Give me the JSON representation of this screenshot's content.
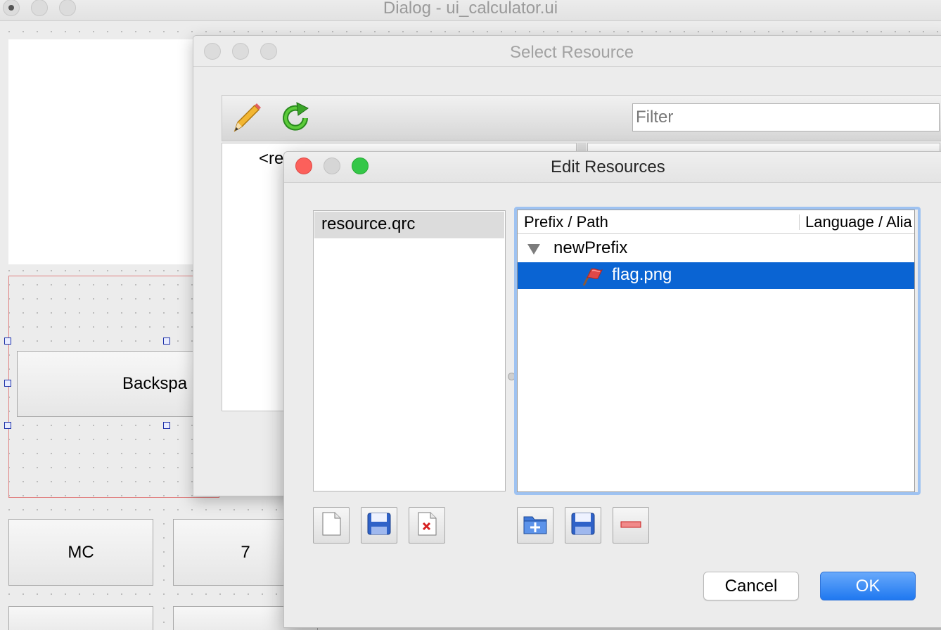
{
  "main_window": {
    "title": "Dialog - ui_calculator.ui"
  },
  "designer": {
    "backspace_label": "Backspa",
    "mc_label": "MC",
    "seven_label": "7"
  },
  "select_resource": {
    "title": "Select Resource",
    "filter_placeholder": "Filter",
    "left_pane_text": "<re",
    "toolbar": {
      "edit_icon": "pencil-icon",
      "reload_icon": "reload-icon"
    }
  },
  "edit_resources": {
    "title": "Edit Resources",
    "qrc_files": [
      "resource.qrc"
    ],
    "tree": {
      "columns": [
        "Prefix / Path",
        "Language / Alia"
      ],
      "rows": [
        {
          "label": "newPrefix",
          "type": "prefix",
          "expanded": true
        },
        {
          "label": "flag.png",
          "type": "file",
          "icon": "flag-icon",
          "selected": true
        }
      ]
    },
    "file_buttons": [
      "new-file-icon",
      "open-file-icon",
      "remove-file-icon"
    ],
    "resource_buttons": [
      "add-folder-icon",
      "add-files-icon",
      "remove-icon"
    ],
    "cancel_label": "Cancel",
    "ok_label": "OK",
    "accent_color": "#0a64d3"
  }
}
